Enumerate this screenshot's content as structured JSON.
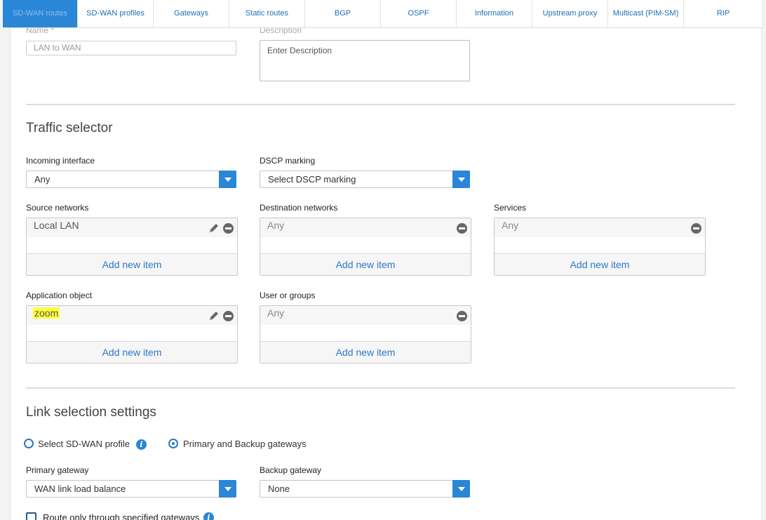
{
  "tabs": [
    {
      "label": "SD-WAN routes",
      "active": true,
      "width": 107
    },
    {
      "label": "SD-WAN profiles",
      "active": false,
      "width": 108
    },
    {
      "label": "Gateways",
      "active": false,
      "width": 108
    },
    {
      "label": "Static routes",
      "active": false,
      "width": 108
    },
    {
      "label": "BGP",
      "active": false,
      "width": 108
    },
    {
      "label": "OSPF",
      "active": false,
      "width": 108
    },
    {
      "label": "Information",
      "active": false,
      "width": 108
    },
    {
      "label": "Upstream proxy",
      "active": false,
      "width": 108
    },
    {
      "label": "Multicast (PIM-SM)",
      "active": false,
      "width": 108
    },
    {
      "label": "RIP",
      "active": false,
      "width": 113
    }
  ],
  "general": {
    "name_label": "Name *",
    "name_value": "LAN to WAN",
    "description_label": "Description",
    "description_placeholder": "Enter Description"
  },
  "traffic_selector": {
    "title": "Traffic selector",
    "incoming_interface": {
      "label": "Incoming interface",
      "value": "Any"
    },
    "dscp_marking": {
      "label": "DSCP marking",
      "value": "Select DSCP marking"
    },
    "source_networks": {
      "label": "Source networks",
      "item": "Local LAN",
      "add": "Add new item"
    },
    "destination_networks": {
      "label": "Destination networks",
      "item": "Any",
      "add": "Add new item"
    },
    "services": {
      "label": "Services",
      "item": "Any",
      "add": "Add new item"
    },
    "application_object": {
      "label": "Application object",
      "item": "zoom",
      "add": "Add new item"
    },
    "user_or_groups": {
      "label": "User or groups",
      "item": "Any",
      "add": "Add new item"
    }
  },
  "link_selection": {
    "title": "Link selection settings",
    "option_profile": "Select SD-WAN profile",
    "option_gateways": "Primary and Backup gateways",
    "selected_option": "gateways",
    "primary_gateway": {
      "label": "Primary gateway",
      "value": "WAN link load balance"
    },
    "backup_gateway": {
      "label": "Backup gateway",
      "value": "None"
    },
    "route_only_label": "Route only through specified gateways"
  },
  "colors": {
    "accent": "#2a86d6",
    "link": "#2a78c4",
    "highlight": "#ffff3c"
  }
}
